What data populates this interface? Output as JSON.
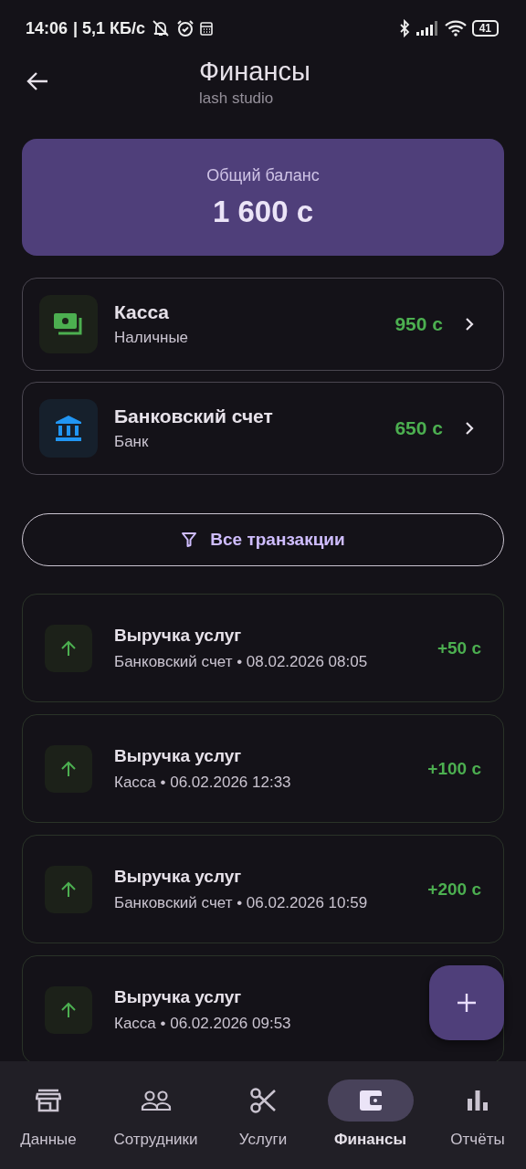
{
  "status_bar": {
    "time": "14:06",
    "speed": "| 5,1 КБ/с",
    "battery": "41"
  },
  "header": {
    "title": "Финансы",
    "subtitle": "lash studio"
  },
  "balance": {
    "label": "Общий баланс",
    "amount": "1 600 с"
  },
  "accounts": [
    {
      "kind": "cash",
      "name": "Касса",
      "type": "Наличные",
      "amount": "950 с"
    },
    {
      "kind": "bank",
      "name": "Банковский счет",
      "type": "Банк",
      "amount": "650 с"
    }
  ],
  "filter_button": "Все транзакции",
  "transactions": [
    {
      "kind": "income",
      "title": "Выручка услуг",
      "details": "Банковский счет • 08.02.2026 08:05",
      "amount": "+50 с"
    },
    {
      "kind": "income",
      "title": "Выручка услуг",
      "details": "Касса • 06.02.2026 12:33",
      "amount": "+100 с"
    },
    {
      "kind": "income",
      "title": "Выручка услуг",
      "details": "Банковский счет • 06.02.2026 10:59",
      "amount": "+200 с"
    },
    {
      "kind": "income",
      "title": "Выручка услуг",
      "details": "Касса • 06.02.2026 09:53"
    }
  ],
  "bottom_nav": [
    {
      "label": "Данные",
      "selected": false
    },
    {
      "label": "Сотрудники",
      "selected": false
    },
    {
      "label": "Услуги",
      "selected": false
    },
    {
      "label": "Финансы",
      "selected": true
    },
    {
      "label": "Отчёты",
      "selected": false
    }
  ]
}
